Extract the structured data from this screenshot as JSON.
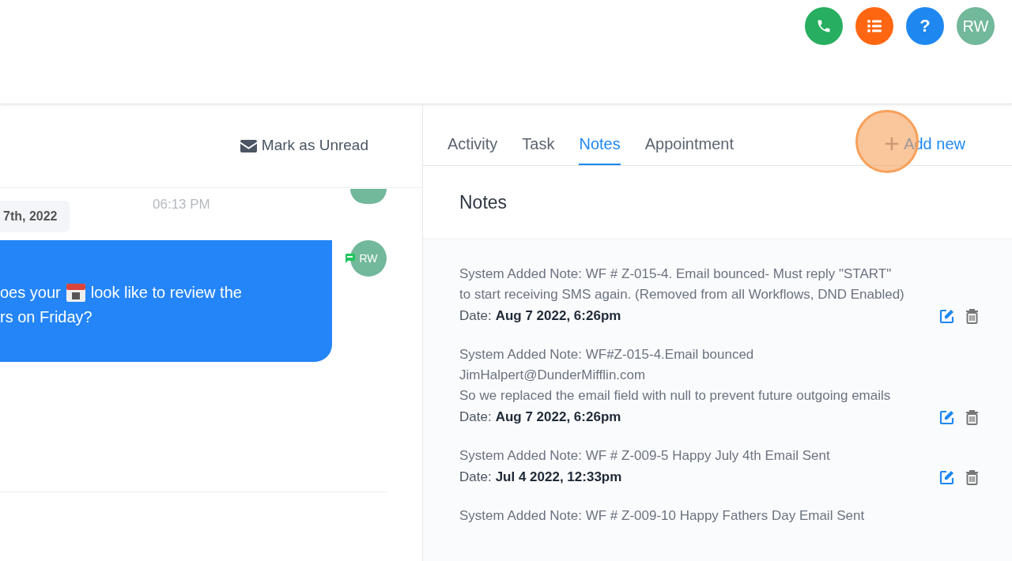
{
  "header": {
    "actions": [
      {
        "kind": "phone",
        "color": "#27ae60"
      },
      {
        "kind": "list",
        "color": "#ff6611"
      },
      {
        "kind": "help",
        "color": "#1e88f0",
        "glyph": "?"
      },
      {
        "kind": "avatar",
        "color": "#72b89a",
        "initials": "RW"
      }
    ]
  },
  "conversation": {
    "mark_unread": "Mark as Unread",
    "time": "06:13 PM",
    "date_chip": "7th, 2022",
    "message": {
      "lines": [
        [
          {
            "kind": "text",
            "text": "oes your"
          },
          {
            "kind": "calendar"
          },
          {
            "kind": "text",
            "text": "look like to review the"
          }
        ],
        [
          {
            "kind": "text",
            "text": "rs on Friday?"
          }
        ]
      ],
      "avatar": "RW"
    }
  },
  "tabs": [
    {
      "label": "Activity",
      "selected": false
    },
    {
      "label": "Task",
      "selected": false
    },
    {
      "label": "Notes",
      "selected": true
    },
    {
      "label": "Appointment",
      "selected": false
    }
  ],
  "add_new": "Add new",
  "notes": {
    "title": "Notes",
    "items": [
      {
        "lines": [
          "System Added Note: WF # Z-015-4. Email bounced- Must reply \"START\"",
          "to start receiving SMS again. (Removed from all Workflows, DND Enabled)"
        ],
        "date_label": "Date:",
        "date": "Aug 7 2022, 6:26pm"
      },
      {
        "lines": [
          "System Added Note: WF#Z-015-4.Email bounced",
          "JimHalpert@DunderMifflin.com",
          "So we replaced the email field with null to prevent future outgoing emails"
        ],
        "date_label": "Date:",
        "date": "Aug 7 2022, 6:26pm"
      },
      {
        "lines": [
          "System Added Note: WF # Z-009-5 Happy July 4th Email Sent"
        ],
        "date_label": "Date:",
        "date": "Jul 4 2022, 12:33pm"
      },
      {
        "lines": [
          "System Added Note: WF # Z-009-10 Happy Fathers Day Email Sent"
        ]
      }
    ]
  }
}
